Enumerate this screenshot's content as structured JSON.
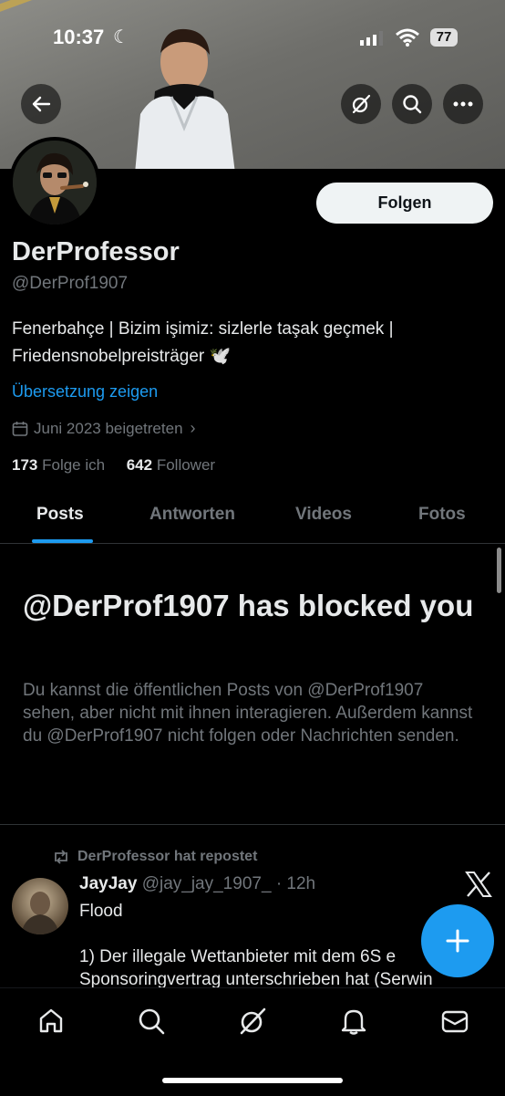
{
  "status_bar": {
    "time": "10:37",
    "battery": "77"
  },
  "header": {
    "back_icon": "back-arrow-icon",
    "actions": [
      "grok-icon",
      "search-icon",
      "more-icon"
    ]
  },
  "profile": {
    "name": "DerProfessor",
    "handle": "@DerProf1907",
    "follow_label": "Folgen",
    "bio_line1": "Fenerbahçe | Bizim işimiz: sizlerle taşak geçmek |",
    "bio_line2": "Friedensnobelpreisträger 🕊️",
    "translate_label": "Übersetzung zeigen",
    "joined": "Juni 2023 beigetreten",
    "following_count": "173",
    "following_label": "Folge ich",
    "followers_count": "642",
    "followers_label": "Follower"
  },
  "tabs": [
    {
      "label": "Posts",
      "active": true
    },
    {
      "label": "Antworten",
      "active": false
    },
    {
      "label": "Videos",
      "active": false
    },
    {
      "label": "Fotos",
      "active": false
    }
  ],
  "blocked": {
    "title": "@DerProf1907 has blocked you",
    "description": "Du kannst die öffentlichen Posts von @DerProf1907 sehen, aber nicht mit ihnen interagieren. Außerdem kannst du @DerProf1907 nicht folgen oder Nachrichten senden."
  },
  "tweet": {
    "repost_label": "DerProfessor hat repostet",
    "author_name": "JayJay",
    "author_handle": "@jay_jay_1907_",
    "time": "· 12h",
    "line1": "Flood",
    "line2": "1) Der illegale Wettanbieter mit dem 6S e",
    "line3": "Sponsoringvertrag unterschrieben hat (Serwin"
  },
  "bottom_nav": [
    "home-icon",
    "search-icon",
    "grok-icon",
    "notifications-icon",
    "messages-icon"
  ],
  "colors": {
    "accent": "#1d9bf0",
    "muted": "#71767b",
    "text": "#e7e9ea",
    "background": "#000000"
  }
}
